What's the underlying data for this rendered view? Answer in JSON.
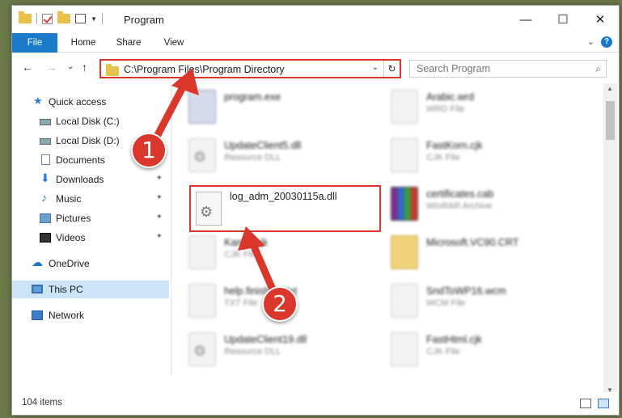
{
  "window": {
    "title": "Program",
    "controls": {
      "minimize": "—",
      "maximize": "☐",
      "close": "✕"
    }
  },
  "ribbon": {
    "tabs": [
      "File",
      "Home",
      "Share",
      "View"
    ],
    "chevron": "⌄",
    "help": "?"
  },
  "nav": {
    "back": "←",
    "forward": "→",
    "recent": "⌄",
    "up": "↑",
    "address": "C:\\Program Files\\Program Directory",
    "address_dropdown": "⌄",
    "refresh": "↻",
    "search_placeholder": "Search Program",
    "search_icon": "⌕"
  },
  "sidebar": {
    "items": [
      {
        "label": "Quick access",
        "icon": "star-icon",
        "glyph": "★"
      },
      {
        "label": "Local Disk (C:)",
        "icon": "drive-icon",
        "glyph": ""
      },
      {
        "label": "Local Disk (D:)",
        "icon": "drive-icon",
        "glyph": ""
      },
      {
        "label": "Documents",
        "icon": "documents-icon",
        "glyph": ""
      },
      {
        "label": "Downloads",
        "icon": "download-icon",
        "glyph": "⬇"
      },
      {
        "label": "Music",
        "icon": "music-icon",
        "glyph": "♪"
      },
      {
        "label": "Pictures",
        "icon": "pictures-icon",
        "glyph": ""
      },
      {
        "label": "Videos",
        "icon": "videos-icon",
        "glyph": ""
      },
      {
        "label": "OneDrive",
        "icon": "cloud-icon",
        "glyph": "☁"
      },
      {
        "label": "This PC",
        "icon": "pc-icon",
        "glyph": ""
      },
      {
        "label": "Network",
        "icon": "network-icon",
        "glyph": ""
      }
    ],
    "pin_glyph": "📌"
  },
  "files": {
    "left_column": [
      {
        "name": "program.exe",
        "type": "",
        "icon": "exe"
      },
      {
        "name": "UpdateClient5.dll",
        "type": "Resource DLL",
        "icon": "dllgear"
      },
      {
        "name": "Kamin.cjk",
        "type": "CJK File",
        "icon": "doc"
      },
      {
        "name": "help.finishder.txt",
        "type": "TXT File",
        "icon": "doc"
      },
      {
        "name": "UpdateClient19.dll",
        "type": "Resource DLL",
        "icon": "dllgear"
      }
    ],
    "right_column": [
      {
        "name": "Arabic.wrd",
        "type": "WRD File",
        "icon": "doc"
      },
      {
        "name": "FastKorn.cjk",
        "type": "CJK File",
        "icon": "doc"
      },
      {
        "name": "certificates.cab",
        "type": "WinRAR Archive",
        "icon": "rar"
      },
      {
        "name": "Microsoft.VC90.CRT",
        "type": "",
        "icon": "folder"
      },
      {
        "name": "SndToWP16.wcm",
        "type": "WCM File",
        "icon": "doc"
      },
      {
        "name": "FastHtml.cjk",
        "type": "CJK File",
        "icon": "doc"
      }
    ],
    "highlighted": {
      "name": "log_adm_20030115a.dll"
    }
  },
  "status": {
    "count": "104 items"
  },
  "annotations": {
    "step1": "1",
    "step2": "2",
    "color": "#d9372b"
  },
  "colors": {
    "accent": "#1979ca",
    "highlight_red": "#d9372b",
    "selected_bg": "#cce4f7"
  }
}
